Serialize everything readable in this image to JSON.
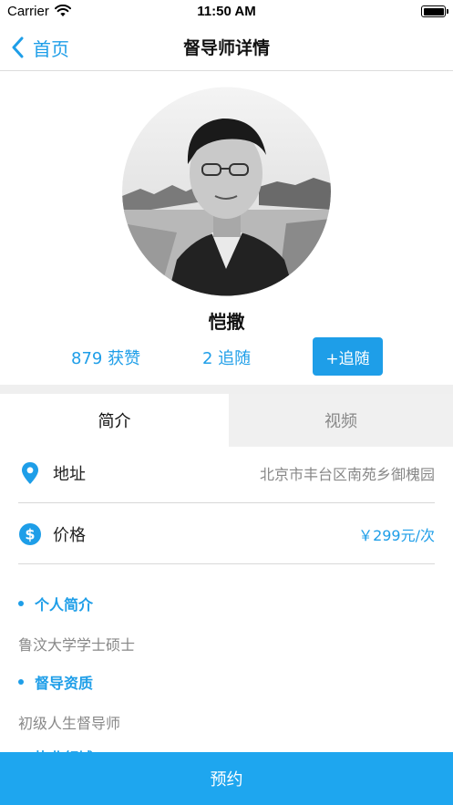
{
  "status_bar": {
    "carrier": "Carrier",
    "time": "11:50 AM",
    "battery_level": 1.0
  },
  "nav": {
    "back_label": "首页",
    "title": "督导师详情"
  },
  "profile": {
    "name": "恺撒",
    "likes": "879 获赞",
    "followers": "2 追随",
    "follow_button": "+追随"
  },
  "tabs": [
    {
      "label": "简介",
      "active": true
    },
    {
      "label": "视频",
      "active": false
    }
  ],
  "details": {
    "address_label": "地址",
    "address_value": "北京市丰台区南苑乡御槐园",
    "price_label": "价格",
    "price_value": "￥299元/次"
  },
  "sections": [
    {
      "title": "个人简介",
      "text": "鲁汶大学学士硕士"
    },
    {
      "title": "督导资质",
      "text": "初级人生督导师"
    },
    {
      "title": "执业领域",
      "text": ""
    }
  ],
  "book_button": "预约",
  "colors": {
    "accent": "#1e9ee8",
    "book_button": "#1ea6ef",
    "muted_text": "#888888",
    "tab_inactive_bg": "#f0f0f0"
  },
  "icons": [
    "wifi-icon",
    "battery-icon",
    "back-chevron-icon",
    "location-pin-icon",
    "dollar-icon",
    "bullet-dot-icon"
  ]
}
